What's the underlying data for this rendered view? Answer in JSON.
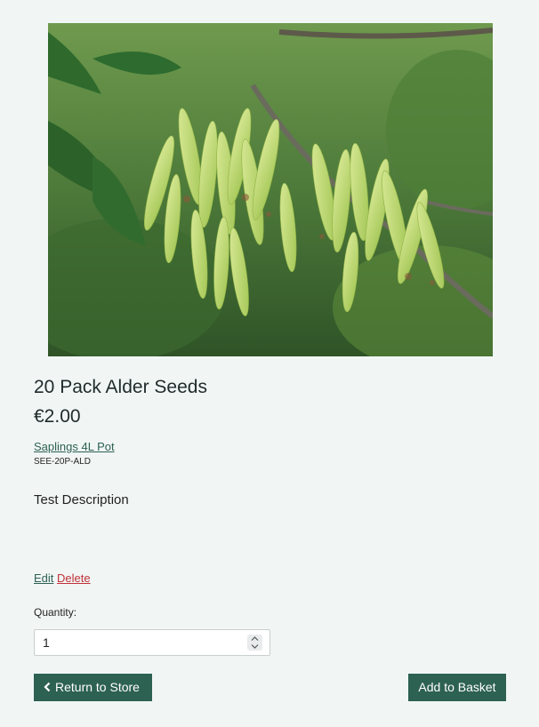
{
  "product": {
    "image_alt": "Alder seeds hanging from branch",
    "title": "20 Pack Alder Seeds",
    "price": "€2.00",
    "category_link": "Saplings 4L Pot",
    "sku": "SEE-20P-ALD",
    "description": "Test Description"
  },
  "admin": {
    "edit_label": "Edit",
    "delete_label": "Delete"
  },
  "quantity": {
    "label": "Quantity:",
    "value": "1"
  },
  "actions": {
    "return_label": "Return to Store",
    "add_label": "Add to Basket"
  },
  "colors": {
    "primary": "#2d6151",
    "danger": "#c0313a",
    "background": "#f1f6f5"
  },
  "icons": {
    "return": "chevron-left-icon",
    "stepper_up": "chevron-up-icon",
    "stepper_down": "chevron-down-icon"
  }
}
